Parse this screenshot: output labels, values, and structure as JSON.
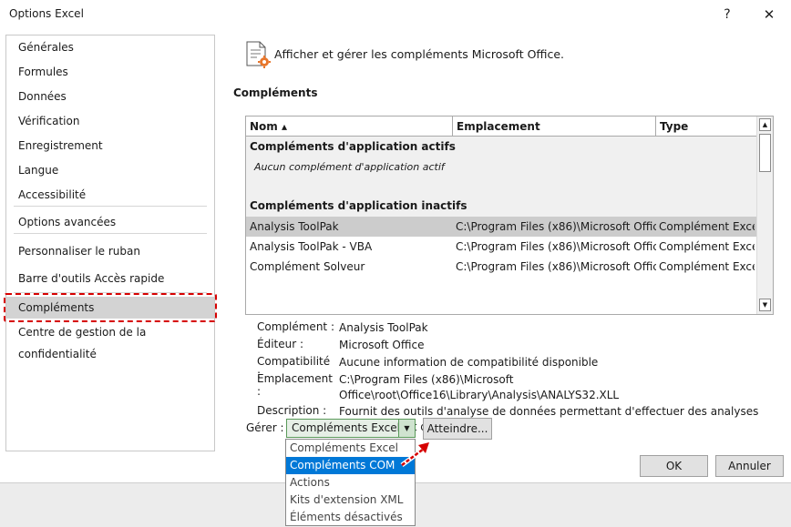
{
  "window": {
    "title": "Options Excel",
    "help_icon": "?",
    "close_icon": "✕"
  },
  "sidebar": {
    "items": [
      {
        "label": "Générales"
      },
      {
        "label": "Formules"
      },
      {
        "label": "Données"
      },
      {
        "label": "Vérification"
      },
      {
        "label": "Enregistrement"
      },
      {
        "label": "Langue"
      },
      {
        "label": "Accessibilité"
      },
      {
        "label": "Options avancées"
      },
      {
        "label": "Personnaliser le ruban"
      },
      {
        "label": "Barre d'outils Accès rapide"
      },
      {
        "label": "Compléments"
      },
      {
        "label": "Centre de gestion de la confidentialité"
      }
    ],
    "selected_label": "Compléments"
  },
  "header": {
    "text": "Afficher et gérer les compléments Microsoft Office.",
    "icon": "addins-gear-icon"
  },
  "section_title": "Compléments",
  "list": {
    "columns": [
      "Nom ▴",
      "Emplacement",
      "Type"
    ],
    "active_group": "Compléments d'application actifs",
    "active_empty": "Aucun complément d'application actif",
    "inactive_group": "Compléments d'application inactifs",
    "rows": [
      {
        "name": "Analysis ToolPak",
        "location": "C:\\Program Files (x86)\\Microsoft Offic",
        "type": "Complément Excel"
      },
      {
        "name": "Analysis ToolPak - VBA",
        "location": "C:\\Program Files (x86)\\Microsoft Offic",
        "type": "Complément Excel"
      },
      {
        "name": "Complément Solveur",
        "location": "C:\\Program Files (x86)\\Microsoft Offic",
        "type": "Complément Excel"
      }
    ]
  },
  "details": {
    "addin_label": "Complément :",
    "addin_value": "Analysis ToolPak",
    "publisher_label": "Éditeur :",
    "publisher_value": "Microsoft Office",
    "compat_label": "Compatibilité :",
    "compat_value": "Aucune information de compatibilité disponible",
    "location_label": "Emplacement :",
    "location_value": "C:\\Program Files (x86)\\Microsoft Office\\root\\Office16\\Library\\Analysis\\ANALYS32.XLL",
    "desc_label": "Description :",
    "desc_value": "Fournit des outils d'analyse de données permettant d'effectuer des analyses statistiques et d'ingénierie"
  },
  "manage": {
    "label": "Gérer :",
    "selected": "Compléments Excel",
    "go_button": "Atteindre...",
    "options": [
      "Compléments Excel",
      "Compléments COM",
      "Actions",
      "Kits d'extension XML",
      "Éléments désactivés"
    ],
    "highlighted_option": "Compléments COM"
  },
  "footer": {
    "ok": "OK",
    "cancel": "Annuler"
  },
  "colors": {
    "selection_blue": "#0078d7",
    "annotation_red": "#d60000"
  }
}
